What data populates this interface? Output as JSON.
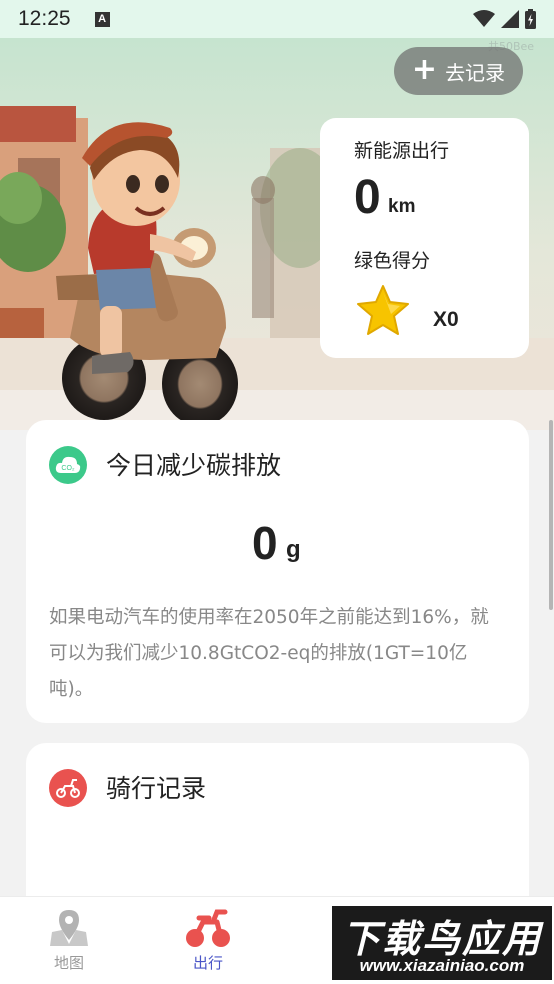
{
  "status_bar": {
    "time": "12:25",
    "notification_badge": "A"
  },
  "hero": {
    "record_button_label": "去记录",
    "corner_watermark": "共50Bee",
    "stats": {
      "new_energy_label": "新能源出行",
      "distance_value": "0",
      "distance_unit": "km",
      "green_score_label": "绿色得分",
      "score_value": "X0"
    }
  },
  "carbon_card": {
    "title": "今日减少碳排放",
    "value": "0",
    "unit": "g",
    "description": "如果电动汽车的使用率在2050年之前能达到16%，就可以为我们减少10.8GtCO2-eq的排放(1GT=10亿吨)。",
    "icon_text": "CO₂"
  },
  "ride_card": {
    "title": "骑行记录"
  },
  "tab_bar": {
    "tabs": [
      {
        "label": "地图",
        "icon": "map-pin-icon",
        "active": false
      },
      {
        "label": "出行",
        "icon": "scooter-icon",
        "active": true
      }
    ]
  },
  "watermark": {
    "title": "下载鸟应用",
    "url": "www.xiazainiao.com"
  },
  "colors": {
    "active_tab": "#4a55c7",
    "accent_red": "#e9524f",
    "co2_green": "#3cc98a",
    "star_yellow": "#f7c400"
  }
}
